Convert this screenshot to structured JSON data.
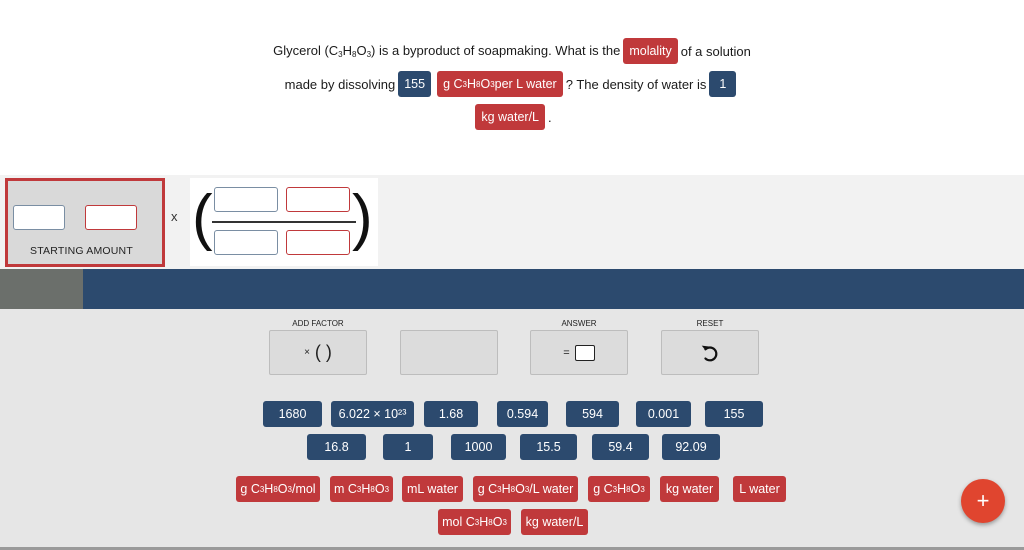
{
  "question": {
    "line1_a": "Glycerol (C",
    "line1_sub1": "3",
    "line1_b": "H",
    "line1_sub2": "8",
    "line1_c": "O",
    "line1_sub3": "3",
    "line1_d": ") is a byproduct of soapmaking. What is the",
    "molality_chip": "molality",
    "line1_e": "of a solution",
    "line2_a": "made by dissolving",
    "chip_155": "155",
    "chip_unit_a": "g C",
    "chip_unit_sub1": "3",
    "chip_unit_b": "H",
    "chip_unit_sub2": "8",
    "chip_unit_c": "O",
    "chip_unit_sub3": "3",
    "chip_unit_d": " per L water",
    "line2_b": "? The density of water is",
    "chip_1": "1",
    "chip_kg": "kg water/L",
    "period": "."
  },
  "work": {
    "starting_label": "STARTING AMOUNT",
    "times": "x"
  },
  "controls": {
    "add_factor_label": "ADD FACTOR",
    "add_factor_times": "×",
    "add_factor_parens": "( )",
    "answer_label": "ANSWER",
    "answer_eq": "=",
    "reset_label": "RESET",
    "reset_icon": "undo-arrow-icon"
  },
  "number_tiles_row1": [
    "1680",
    "6.022 × 10²³",
    "1.68",
    "0.594",
    "594",
    "0.001",
    "155"
  ],
  "number_tiles_row2": [
    "16.8",
    "1",
    "1000",
    "15.5",
    "59.4",
    "92.09"
  ],
  "unit_tiles": {
    "u1": {
      "a": "g C",
      "s1": "3",
      "b": "H",
      "s2": "8",
      "c": "O",
      "s3": "3",
      "d": "/mol"
    },
    "u2": {
      "a": "m C",
      "s1": "3",
      "b": "H",
      "s2": "8",
      "c": "O",
      "s3": "3"
    },
    "u3": "mL water",
    "u4": {
      "a": "g C",
      "s1": "3",
      "b": "H",
      "s2": "8",
      "c": "O",
      "s3": "3",
      "d": "/L water"
    },
    "u5": {
      "a": "g C",
      "s1": "3",
      "b": "H",
      "s2": "8",
      "c": "O",
      "s3": "3"
    },
    "u6": "kg water",
    "u7": "L water",
    "u8": {
      "a": "mol C",
      "s1": "3",
      "b": "H",
      "s2": "8",
      "c": "O",
      "s3": "3"
    },
    "u9": "kg water/L"
  },
  "fab_label": "+",
  "colors": {
    "number_tile": "#2c4a6e",
    "unit_tile": "#c0393b",
    "fab": "#e0452f",
    "bar": "#2c4a6e"
  }
}
